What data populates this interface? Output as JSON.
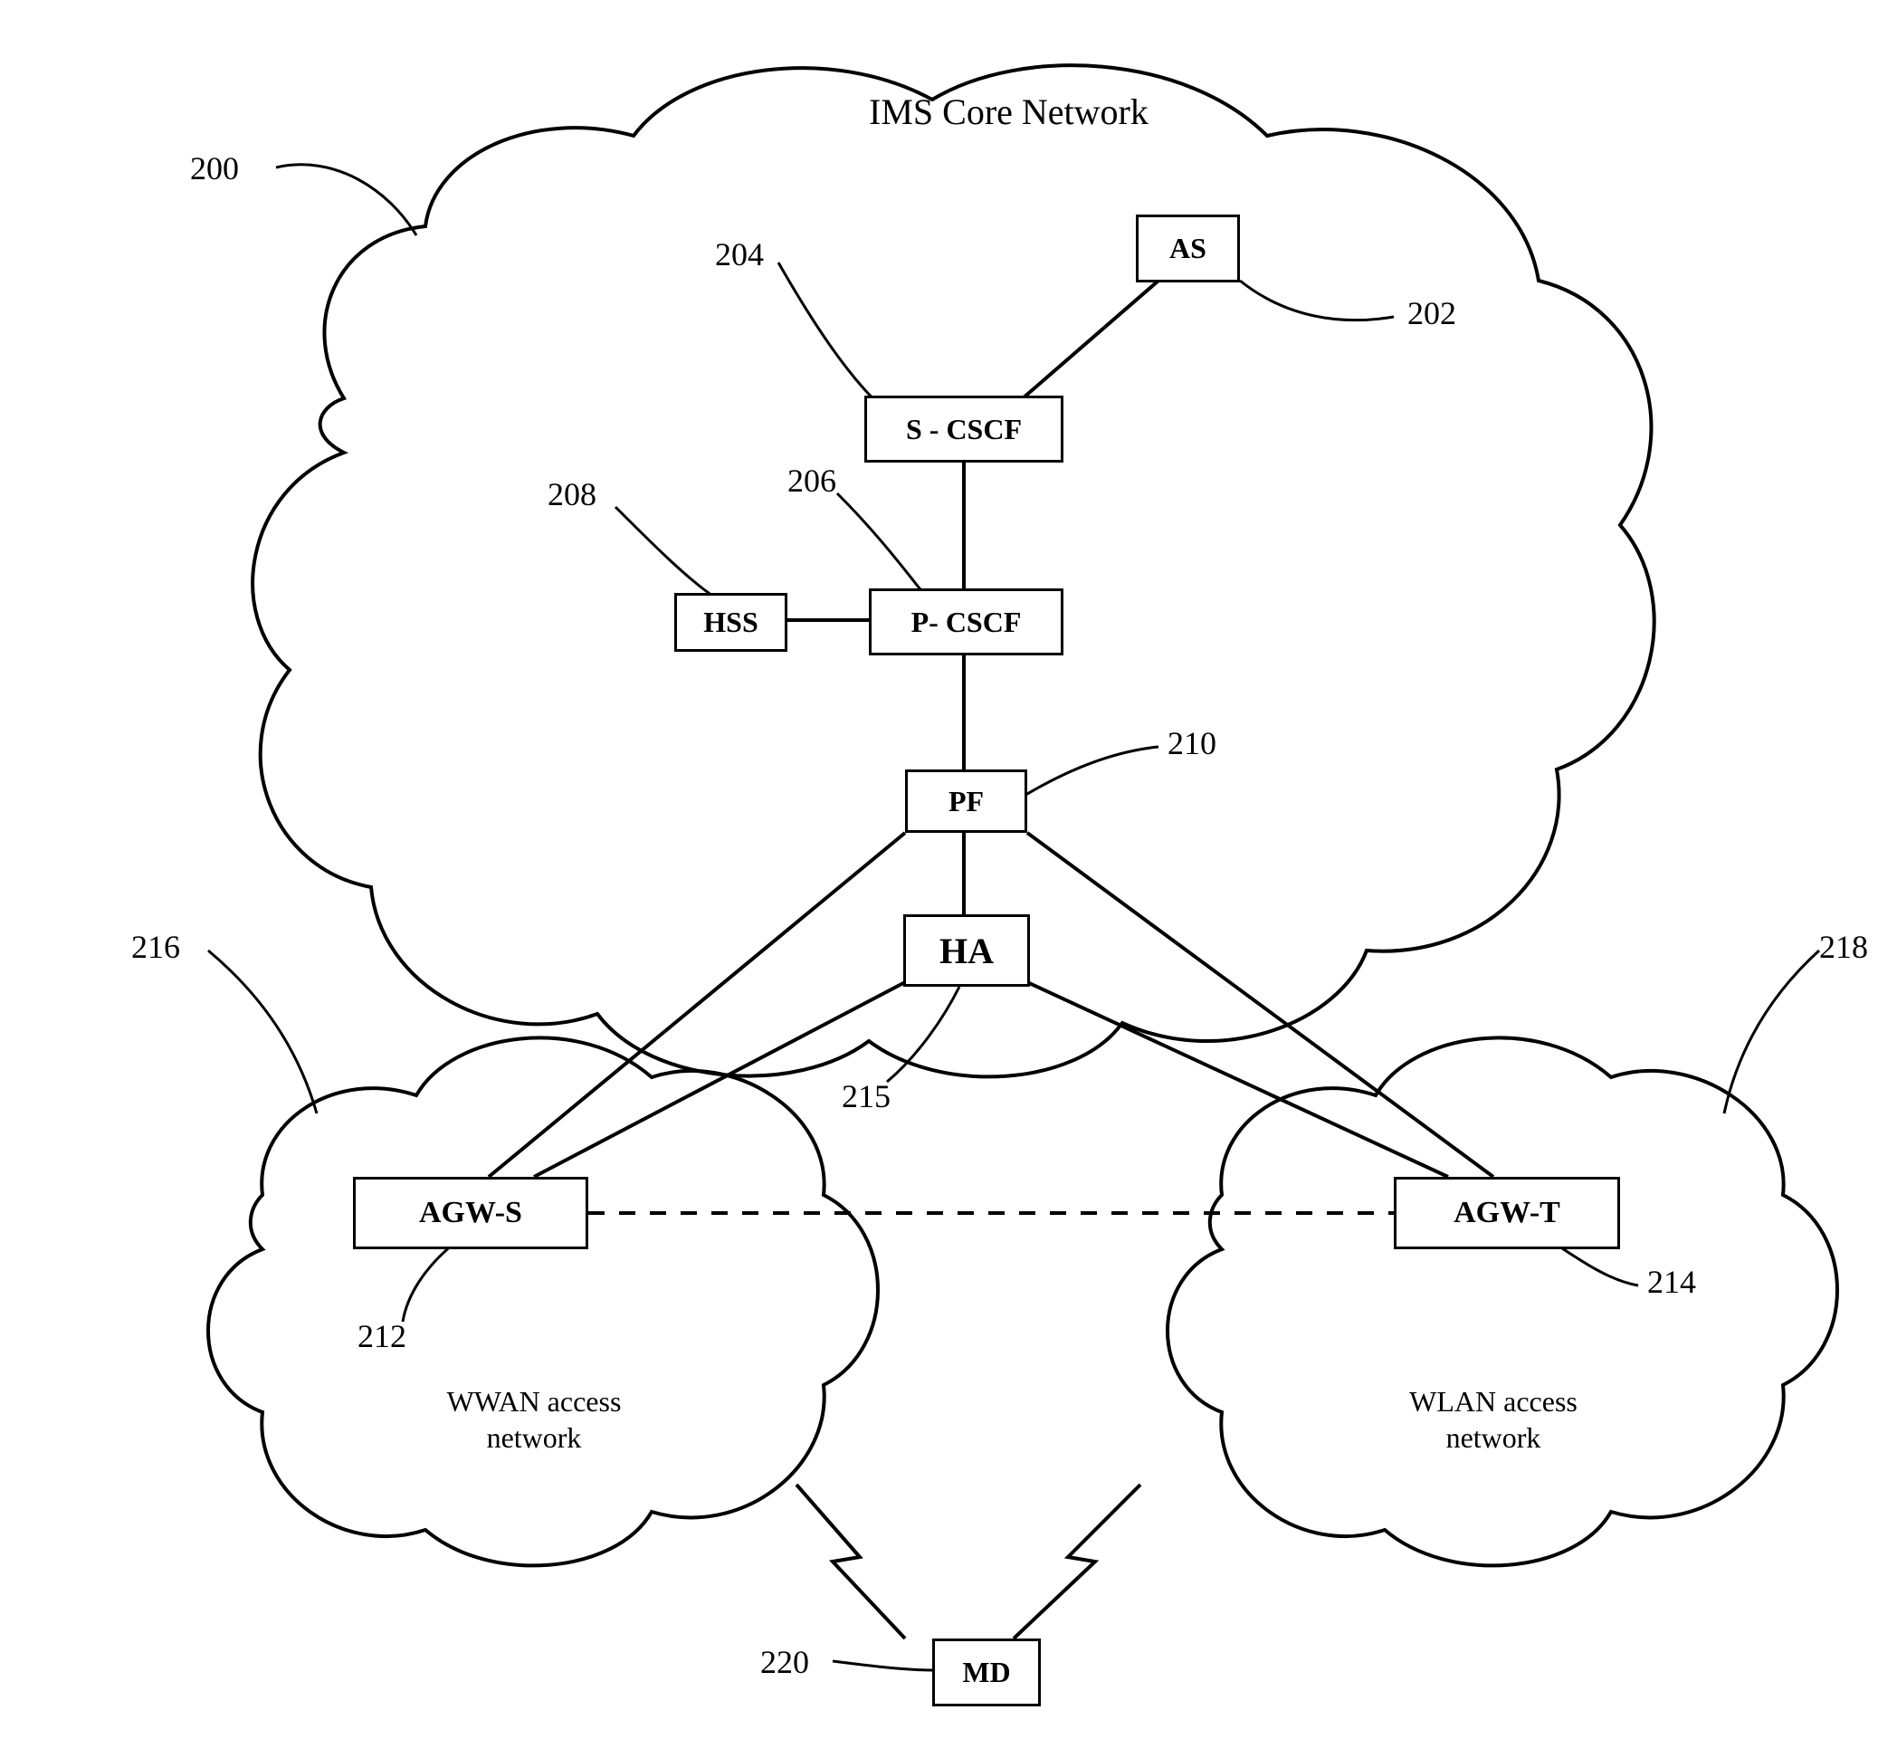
{
  "chart_data": {
    "type": "diagram",
    "title": "IMS Core Network",
    "nodes": [
      {
        "id": "AS",
        "label": "AS",
        "ref": "202",
        "cloud": "core"
      },
      {
        "id": "S-CSCF",
        "label": "S - CSCF",
        "ref": "204",
        "cloud": "core"
      },
      {
        "id": "P-CSCF",
        "label": "P- CSCF",
        "ref": "206",
        "cloud": "core"
      },
      {
        "id": "HSS",
        "label": "HSS",
        "ref": "208",
        "cloud": "core"
      },
      {
        "id": "PF",
        "label": "PF",
        "ref": "210",
        "cloud": "core"
      },
      {
        "id": "HA",
        "label": "HA",
        "ref": "215",
        "cloud": "core-edge"
      },
      {
        "id": "AGW-S",
        "label": "AGW-S",
        "ref": "212",
        "cloud": "wwan"
      },
      {
        "id": "AGW-T",
        "label": "AGW-T",
        "ref": "214",
        "cloud": "wlan"
      },
      {
        "id": "MD",
        "label": "MD",
        "ref": "220",
        "cloud": "none"
      }
    ],
    "clouds": [
      {
        "id": "core",
        "label": "IMS Core Network",
        "ref": "200"
      },
      {
        "id": "wwan",
        "label": "WWAN access network",
        "ref": "216"
      },
      {
        "id": "wlan",
        "label": "WLAN access network",
        "ref": "218"
      }
    ],
    "edges": [
      {
        "from": "AS",
        "to": "S-CSCF",
        "style": "solid"
      },
      {
        "from": "S-CSCF",
        "to": "P-CSCF",
        "style": "solid"
      },
      {
        "from": "P-CSCF",
        "to": "HSS",
        "style": "solid"
      },
      {
        "from": "P-CSCF",
        "to": "PF",
        "style": "solid"
      },
      {
        "from": "PF",
        "to": "HA",
        "style": "solid"
      },
      {
        "from": "PF",
        "to": "AGW-S",
        "style": "solid"
      },
      {
        "from": "PF",
        "to": "AGW-T",
        "style": "solid"
      },
      {
        "from": "HA",
        "to": "AGW-S",
        "style": "solid"
      },
      {
        "from": "HA",
        "to": "AGW-T",
        "style": "solid"
      },
      {
        "from": "AGW-S",
        "to": "AGW-T",
        "style": "dashed"
      },
      {
        "from": "wwan",
        "to": "MD",
        "style": "wireless"
      },
      {
        "from": "wlan",
        "to": "MD",
        "style": "wireless"
      }
    ]
  },
  "title": "IMS Core Network",
  "clouds": {
    "core": {
      "label": "IMS Core Network",
      "ref": "200"
    },
    "wwan": {
      "label1": "WWAN access",
      "label2": "network",
      "ref": "216"
    },
    "wlan": {
      "label1": "WLAN access",
      "label2": "network",
      "ref": "218"
    }
  },
  "boxes": {
    "as": {
      "label": "AS",
      "ref": "202"
    },
    "scscf": {
      "label": "S - CSCF",
      "ref": "204"
    },
    "pcscf": {
      "label": "P- CSCF",
      "ref": "206"
    },
    "hss": {
      "label": "HSS",
      "ref": "208"
    },
    "pf": {
      "label": "PF",
      "ref": "210"
    },
    "ha": {
      "label": "HA",
      "ref": "215"
    },
    "agws": {
      "label": "AGW-S",
      "ref": "212"
    },
    "agwt": {
      "label": "AGW-T",
      "ref": "214"
    },
    "md": {
      "label": "MD",
      "ref": "220"
    }
  }
}
